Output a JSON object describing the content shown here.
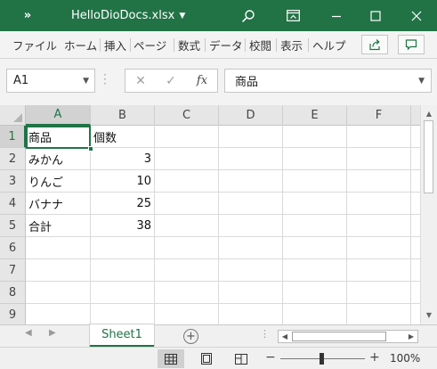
{
  "app": {
    "title": "HelloDioDocs.xlsx",
    "qat_label": "»",
    "accent_color": "#217346"
  },
  "ribbon": {
    "tabs": [
      "ファイル",
      "ホーム",
      "挿入",
      "ページ",
      "数式",
      "データ",
      "校閲",
      "表示",
      "ヘルプ"
    ],
    "share_icon": "share-icon",
    "comments_icon": "comment-icon"
  },
  "formula_bar": {
    "name_box": "A1",
    "fx_label": "fx",
    "content": "商品"
  },
  "grid": {
    "columns": [
      "A",
      "B",
      "C",
      "D",
      "E",
      "F"
    ],
    "rows": [
      "1",
      "2",
      "3",
      "4",
      "5",
      "6",
      "7",
      "8",
      "9"
    ],
    "cells": [
      [
        "商品",
        "個数"
      ],
      [
        "みかん",
        "3"
      ],
      [
        "りんご",
        "10"
      ],
      [
        "バナナ",
        "25"
      ],
      [
        "合計",
        "38"
      ]
    ],
    "selected_cell": "A1"
  },
  "sheets": {
    "tabs": [
      "Sheet1"
    ],
    "active": "Sheet1",
    "add_label": "+"
  },
  "status": {
    "zoom": "100%",
    "zoom_value": 100,
    "views": [
      "normal-view-icon",
      "page-layout-icon",
      "page-break-preview-icon"
    ]
  }
}
